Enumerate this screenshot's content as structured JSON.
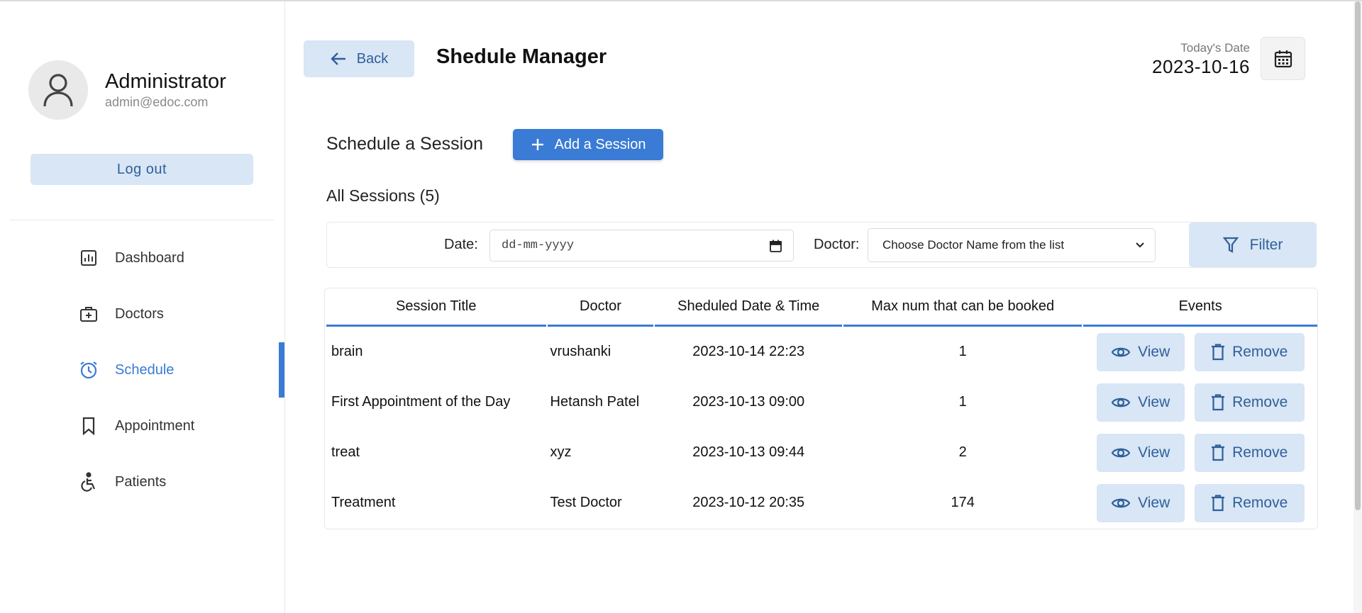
{
  "profile": {
    "name": "Administrator",
    "email": "admin@edoc.com",
    "logout_label": "Log out"
  },
  "nav": {
    "items": [
      {
        "label": "Dashboard",
        "icon": "chart-icon"
      },
      {
        "label": "Doctors",
        "icon": "medical-kit-icon"
      },
      {
        "label": "Schedule",
        "icon": "alarm-clock-icon",
        "active": true
      },
      {
        "label": "Appointment",
        "icon": "bookmark-icon"
      },
      {
        "label": "Patients",
        "icon": "wheelchair-icon"
      }
    ]
  },
  "header": {
    "back_label": "Back",
    "title": "Shedule Manager",
    "today_label": "Today's Date",
    "today_value": "2023-10-16"
  },
  "schedule": {
    "heading": "Schedule a Session",
    "add_label": "Add a Session",
    "all_sessions": "All Sessions (5)"
  },
  "filter": {
    "date_label": "Date:",
    "date_placeholder": "dd-mm-yyyy",
    "doctor_label": "Doctor:",
    "doctor_selected": "Choose Doctor Name from the list",
    "filter_label": "Filter"
  },
  "table": {
    "headers": [
      "Session Title",
      "Doctor",
      "Sheduled Date & Time",
      "Max num that can be booked",
      "Events"
    ],
    "view_label": "View",
    "remove_label": "Remove",
    "rows": [
      {
        "title": "brain",
        "doctor": "vrushanki",
        "datetime": "2023-10-14 22:23",
        "max": "1"
      },
      {
        "title": "First Appointment of the Day",
        "doctor": "Hetansh Patel",
        "datetime": "2023-10-13 09:00",
        "max": "1"
      },
      {
        "title": "treat",
        "doctor": "xyz",
        "datetime": "2023-10-13 09:44",
        "max": "2"
      },
      {
        "title": "Treatment",
        "doctor": "Test Doctor",
        "datetime": "2023-10-12 20:35",
        "max": "174"
      }
    ]
  },
  "colors": {
    "accent": "#3a7bd5",
    "soft_button": "#d8e6f5",
    "soft_button_text": "#2f5f9a"
  }
}
